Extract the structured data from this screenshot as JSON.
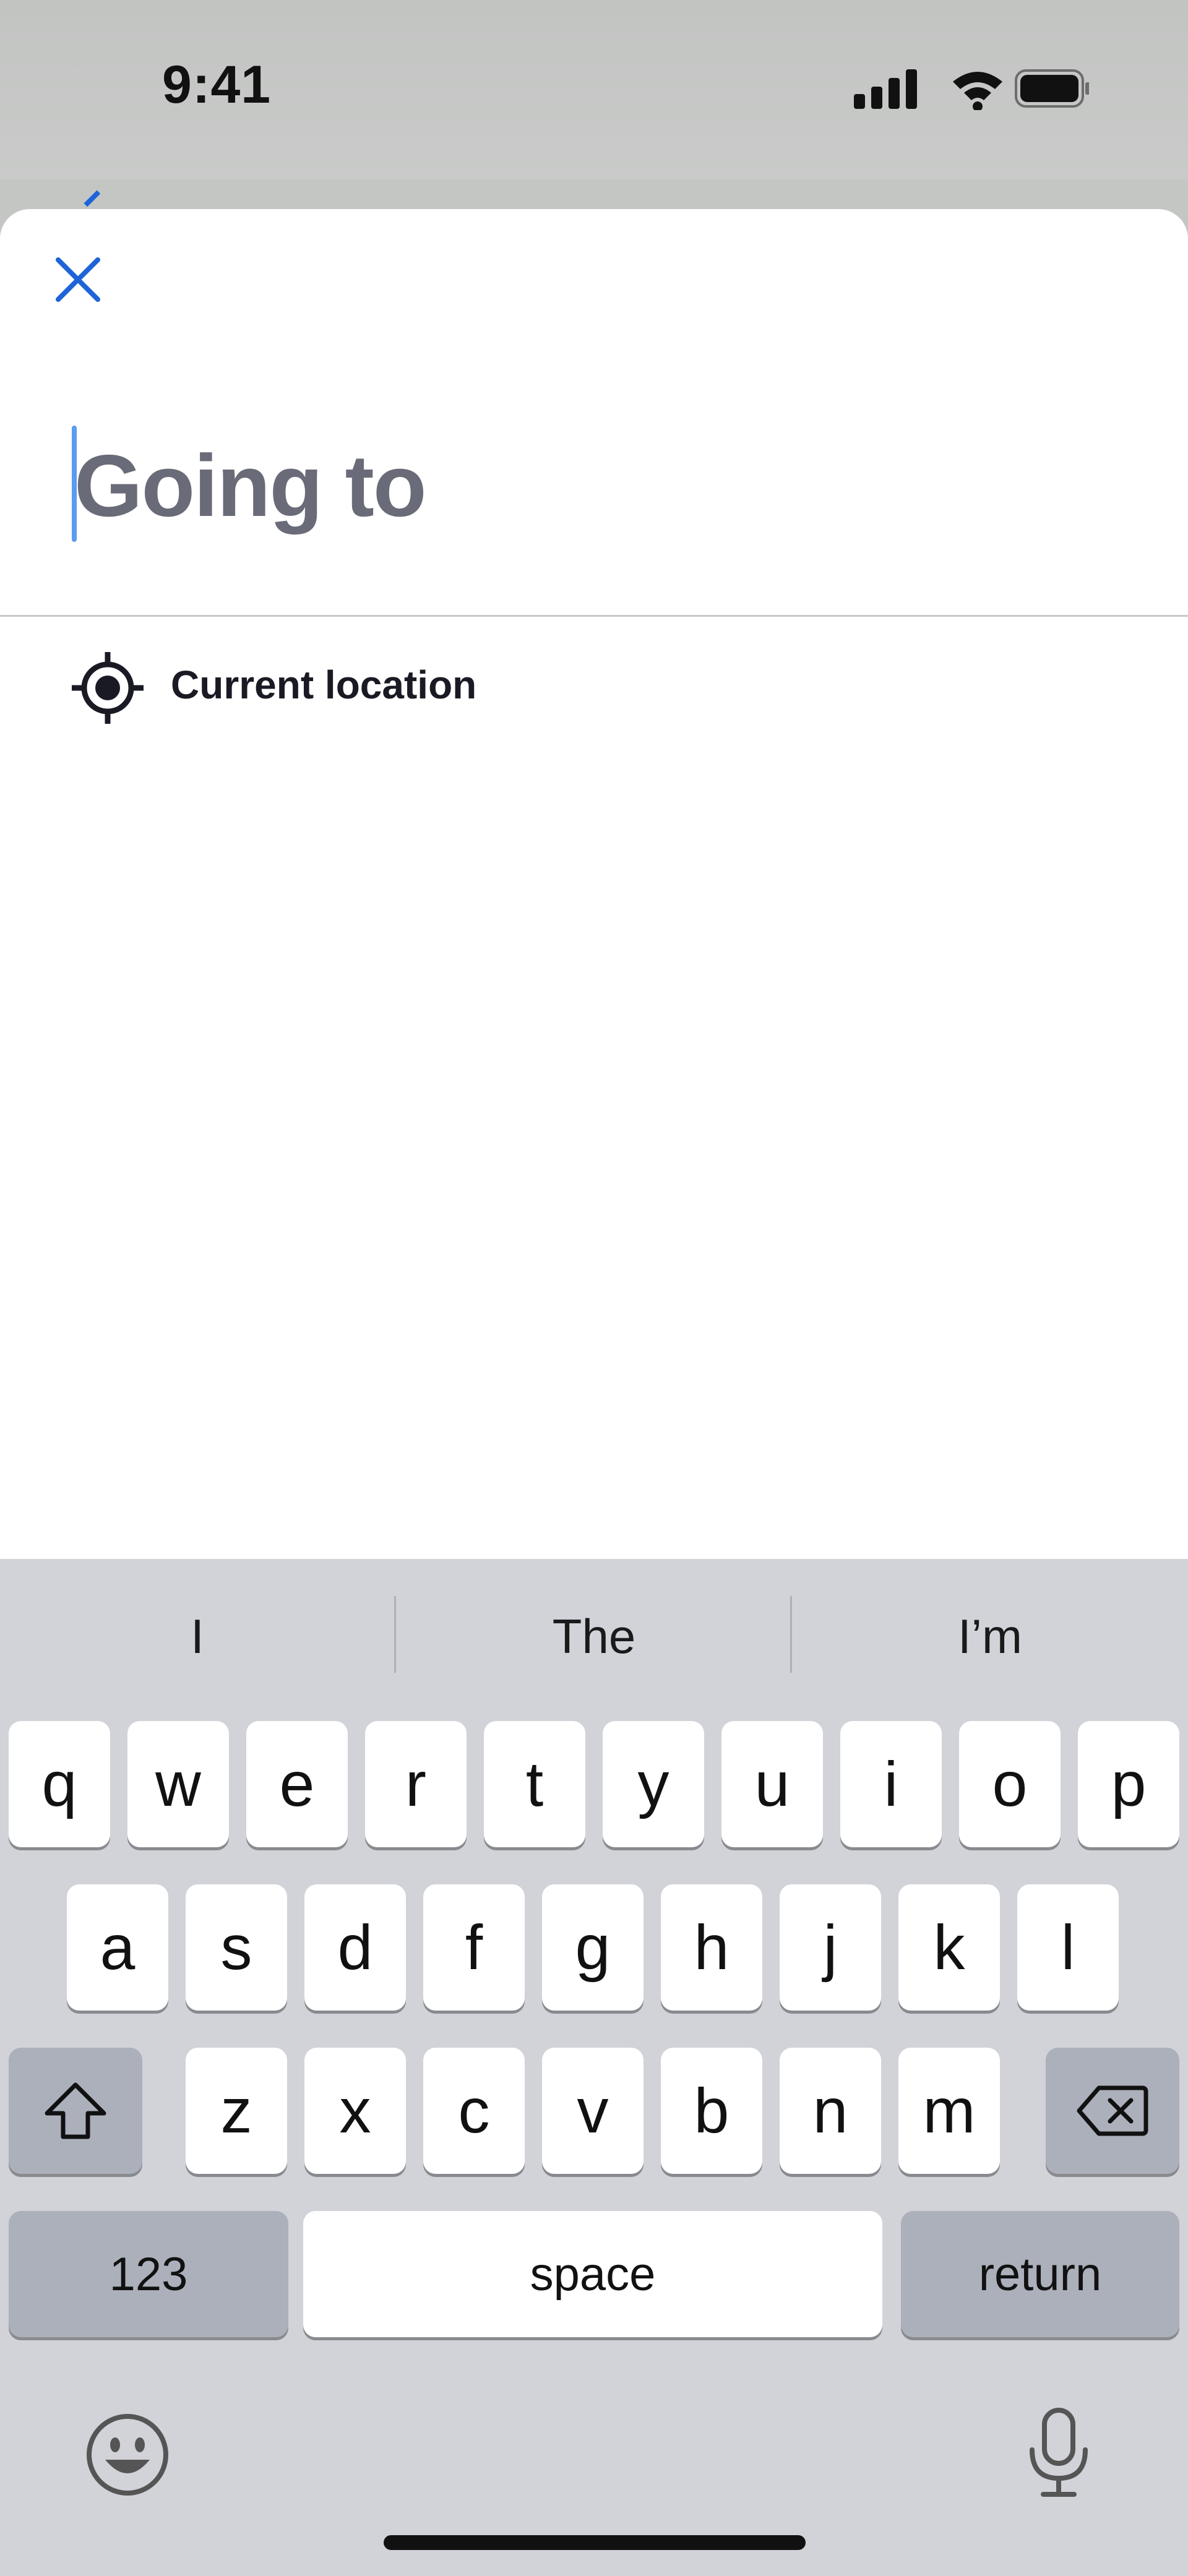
{
  "status_bar": {
    "time": "9:41",
    "icons": [
      "cellular-signal-icon",
      "wifi-icon",
      "battery-icon"
    ]
  },
  "sheet": {
    "close_icon": "close-icon",
    "search_placeholder": "Going to",
    "suggestions": [
      {
        "icon": "current-location-icon",
        "label": "Current location"
      }
    ]
  },
  "keyboard": {
    "predictions": [
      "I",
      "The",
      "I’m"
    ],
    "row1": [
      "q",
      "w",
      "e",
      "r",
      "t",
      "y",
      "u",
      "i",
      "o",
      "p"
    ],
    "row2": [
      "a",
      "s",
      "d",
      "f",
      "g",
      "h",
      "j",
      "k",
      "l"
    ],
    "row3": [
      "z",
      "x",
      "c",
      "v",
      "b",
      "n",
      "m"
    ],
    "numbers_label": "123",
    "space_label": "space",
    "return_label": "return",
    "shift_icon": "shift-icon",
    "delete_icon": "delete-icon",
    "emoji_icon": "emoji-icon",
    "mic_icon": "microphone-icon"
  },
  "colors": {
    "accent": "#1e64d8",
    "caret": "#5b9bf0",
    "placeholder": "#6a6b78",
    "keyboard_bg": "#d1d3d9"
  }
}
